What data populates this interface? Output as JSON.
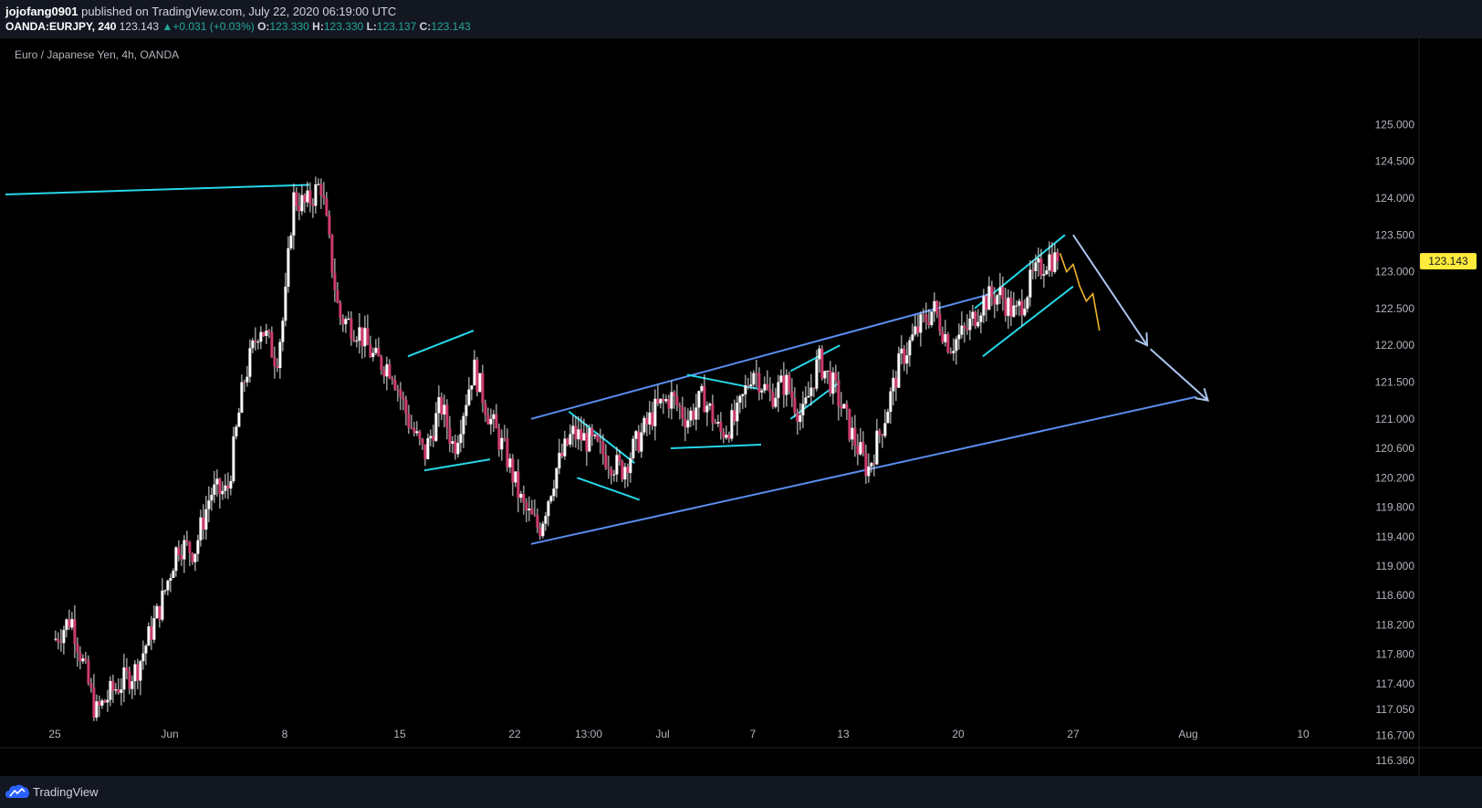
{
  "header": {
    "author": "jojofang0901",
    "published_text": "published on TradingView.com, July 22, 2020 06:19:00 UTC",
    "symbol": "OANDA:EURJPY, 240",
    "price": "123.143",
    "change_icon": "up-triangle-icon",
    "change": "+0.031 (+0.03%)",
    "o_label": "O:",
    "o_value": "123.330",
    "h_label": "H:",
    "h_value": "123.330",
    "l_label": "L:",
    "l_value": "123.137",
    "c_label": "C:",
    "c_value": "123.143"
  },
  "footer": {
    "brand": "TradingView",
    "logo_icon": "tradingview-cloud-icon"
  },
  "colors": {
    "background": "#000000",
    "panel": "#131722",
    "candle": "#cf3b6e",
    "candle_wick": "#e6e6e6",
    "cyan_line": "#26d7e8",
    "blue_line": "#5b8dee",
    "arrow": "#aac4ee",
    "projection": "#f2b52c",
    "price_tag": "#ffeb3b"
  },
  "chart_data": {
    "type": "candlestick",
    "title": "Euro / Japanese Yen, 4h, OANDA",
    "current_price": "123.143",
    "y_ticks": [
      "125.000",
      "124.500",
      "124.000",
      "123.500",
      "123.000",
      "122.500",
      "122.000",
      "121.500",
      "121.000",
      "120.600",
      "120.200",
      "119.800",
      "119.400",
      "119.000",
      "118.600",
      "118.200",
      "117.800",
      "117.400",
      "117.050",
      "116.700",
      "116.360"
    ],
    "x_ticks": [
      "25",
      "Jun",
      "8",
      "15",
      "22",
      "13:00",
      "Jul",
      "7",
      "13",
      "20",
      "27",
      "Aug",
      "10"
    ],
    "x_tick_units": [
      0,
      7,
      14,
      21,
      28,
      32.5,
      37,
      42.5,
      48,
      55,
      62,
      69,
      76
    ],
    "price_path": [
      [
        0,
        118.0
      ],
      [
        1,
        118.3
      ],
      [
        2.5,
        117.0
      ],
      [
        3.5,
        117.3
      ],
      [
        5,
        117.6
      ],
      [
        6.5,
        118.5
      ],
      [
        7.5,
        119.3
      ],
      [
        8.5,
        119.2
      ],
      [
        9.5,
        120.0
      ],
      [
        10.5,
        120.0
      ],
      [
        11.5,
        121.5
      ],
      [
        12.5,
        122.3
      ],
      [
        13.5,
        121.8
      ],
      [
        14,
        122.5
      ],
      [
        14.5,
        124.0
      ],
      [
        15.3,
        123.9
      ],
      [
        16.2,
        124.2
      ],
      [
        17.3,
        122.4
      ],
      [
        18.5,
        122.2
      ],
      [
        19.5,
        121.8
      ],
      [
        20.5,
        121.7
      ],
      [
        21.5,
        121.0
      ],
      [
        22.5,
        120.5
      ],
      [
        23.5,
        121.2
      ],
      [
        24.3,
        120.6
      ],
      [
        25.5,
        121.7
      ],
      [
        26.5,
        121.0
      ],
      [
        27.5,
        120.5
      ],
      [
        28.5,
        119.8
      ],
      [
        29.5,
        119.5
      ],
      [
        30.5,
        120.3
      ],
      [
        31.5,
        120.8
      ],
      [
        32.5,
        120.7
      ],
      [
        33.5,
        120.5
      ],
      [
        34.5,
        120.3
      ],
      [
        35.5,
        120.7
      ],
      [
        36.5,
        121.1
      ],
      [
        37.5,
        121.3
      ],
      [
        38.5,
        121.0
      ],
      [
        39.5,
        121.3
      ],
      [
        40.5,
        120.8
      ],
      [
        41.5,
        121.0
      ],
      [
        42.5,
        121.7
      ],
      [
        43.5,
        121.3
      ],
      [
        44.5,
        121.5
      ],
      [
        45.5,
        121.0
      ],
      [
        46.5,
        121.8
      ],
      [
        47.5,
        121.4
      ],
      [
        48.5,
        120.8
      ],
      [
        49.5,
        120.3
      ],
      [
        50.5,
        121.0
      ],
      [
        51.5,
        121.8
      ],
      [
        52.5,
        122.2
      ],
      [
        53.5,
        122.5
      ],
      [
        54.5,
        122.0
      ],
      [
        55.5,
        122.2
      ],
      [
        56.5,
        122.6
      ],
      [
        57.5,
        122.7
      ],
      [
        58.5,
        122.4
      ],
      [
        59.5,
        122.9
      ],
      [
        60.5,
        123.2
      ],
      [
        61.1,
        123.14
      ]
    ],
    "projection_path": [
      [
        61.2,
        123.25
      ],
      [
        61.6,
        123.0
      ],
      [
        62,
        123.1
      ],
      [
        62.4,
        122.8
      ],
      [
        62.8,
        122.6
      ],
      [
        63.2,
        122.7
      ],
      [
        63.6,
        122.2
      ]
    ],
    "lines": [
      {
        "kind": "resistance",
        "color": "cyan",
        "from": [
          -3,
          124.05
        ],
        "to": [
          15.5,
          124.18
        ]
      },
      {
        "kind": "channel-top",
        "color": "blue",
        "from": [
          29,
          121.0
        ],
        "to": [
          57,
          122.7
        ]
      },
      {
        "kind": "channel-bottom",
        "color": "blue",
        "from": [
          29,
          119.3
        ],
        "to": [
          69.5,
          121.3
        ]
      },
      {
        "kind": "flag",
        "color": "cyan",
        "from": [
          21.5,
          121.85
        ],
        "to": [
          25.5,
          122.2
        ]
      },
      {
        "kind": "flag",
        "color": "cyan",
        "from": [
          22.5,
          120.3
        ],
        "to": [
          26.5,
          120.45
        ]
      },
      {
        "kind": "wedge",
        "color": "cyan",
        "from": [
          31.3,
          121.1
        ],
        "to": [
          35.3,
          120.4
        ]
      },
      {
        "kind": "wedge",
        "color": "cyan",
        "from": [
          31.8,
          120.2
        ],
        "to": [
          35.6,
          119.9
        ]
      },
      {
        "kind": "triangle",
        "color": "cyan",
        "from": [
          38.5,
          121.6
        ],
        "to": [
          43,
          121.4
        ]
      },
      {
        "kind": "triangle",
        "color": "cyan",
        "from": [
          37.5,
          120.6
        ],
        "to": [
          43,
          120.65
        ]
      },
      {
        "kind": "channel",
        "color": "cyan",
        "from": [
          44.8,
          121.65
        ],
        "to": [
          47.8,
          122.0
        ]
      },
      {
        "kind": "channel",
        "color": "cyan",
        "from": [
          44.8,
          121.0
        ],
        "to": [
          47.8,
          121.5
        ]
      },
      {
        "kind": "rising-wedge",
        "color": "cyan",
        "from": [
          56,
          122.5
        ],
        "to": [
          61.5,
          123.5
        ]
      },
      {
        "kind": "rising-wedge",
        "color": "cyan",
        "from": [
          56.5,
          121.85
        ],
        "to": [
          62,
          122.8
        ]
      }
    ],
    "arrows": [
      {
        "from": [
          62,
          123.5
        ],
        "to": [
          66.5,
          122.0
        ]
      },
      {
        "from": [
          66.7,
          121.95
        ],
        "to": [
          70.2,
          121.25
        ]
      }
    ]
  }
}
